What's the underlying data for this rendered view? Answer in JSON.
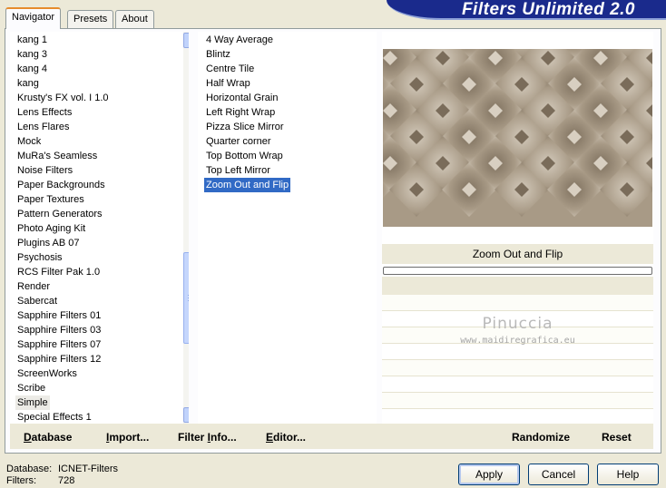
{
  "app": {
    "title": "Filters Unlimited 2.0"
  },
  "tabs": [
    {
      "label": "Navigator"
    },
    {
      "label": "Presets"
    },
    {
      "label": "About"
    }
  ],
  "categories": {
    "items": [
      "kang 1",
      "kang 3",
      "kang 4",
      "kang",
      "Krusty's FX vol. I 1.0",
      "Lens Effects",
      "Lens Flares",
      "Mock",
      "MuRa's Seamless",
      "Noise Filters",
      "Paper Backgrounds",
      "Paper Textures",
      "Pattern Generators",
      "Photo Aging Kit",
      "Plugins AB 07",
      "Psychosis",
      "RCS Filter Pak 1.0",
      "Render",
      "Sabercat",
      "Sapphire Filters 01",
      "Sapphire Filters 03",
      "Sapphire Filters 07",
      "Sapphire Filters 12",
      "ScreenWorks",
      "Scribe",
      "Simple",
      "Special Effects 1"
    ],
    "highlighted": "Simple",
    "scroll_position": 0.62
  },
  "filters": {
    "items": [
      "4 Way Average",
      "Blintz",
      "Centre Tile",
      "Half Wrap",
      "Horizontal Grain",
      "Left Right Wrap",
      "Pizza Slice Mirror",
      "Quarter corner",
      "Top Bottom Wrap",
      "Top Left Mirror",
      "Zoom Out and Flip"
    ],
    "selected": "Zoom Out and Flip"
  },
  "preview": {
    "filter_name": "Zoom Out and Flip",
    "progress": 0,
    "watermark_name": "Pinuccia",
    "watermark_url": "www.maidiregrafica.eu",
    "colors": {
      "dark": "#7a6c5a",
      "light": "#d8cfc1",
      "mid": "#a89a86"
    }
  },
  "toolbar": {
    "database_pre": "",
    "database_ul": "D",
    "database_post": "atabase",
    "import_pre": "",
    "import_ul": "I",
    "import_post": "mport...",
    "filterinfo_pre": "Filter ",
    "filterinfo_ul": "I",
    "filterinfo_post": "nfo...",
    "editor_pre": "",
    "editor_ul": "E",
    "editor_post": "ditor...",
    "randomize": "Randomize",
    "reset": "Reset"
  },
  "status": {
    "database_label": "Database:",
    "database_value": "ICNET-Filters",
    "filters_label": "Filters:",
    "filters_value": "728"
  },
  "buttons": {
    "apply": "Apply",
    "cancel": "Cancel",
    "help": "Help"
  }
}
